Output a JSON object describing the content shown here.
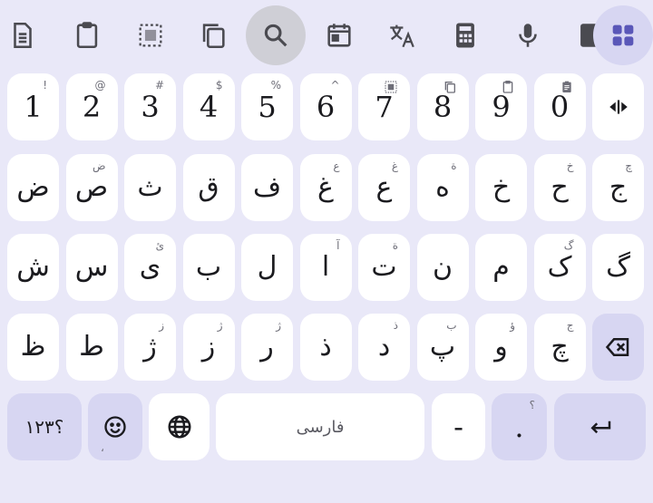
{
  "toolbar": {
    "items": [
      "clipboard-text",
      "clipboard",
      "select-all",
      "copy",
      "search",
      "calendar",
      "translate",
      "calculator",
      "microphone",
      "more",
      "apps-grid"
    ]
  },
  "keyboard": {
    "number_row": [
      {
        "main": "1",
        "hint": "!"
      },
      {
        "main": "2",
        "hint": "@"
      },
      {
        "main": "3",
        "hint": "#"
      },
      {
        "main": "4",
        "hint": "$"
      },
      {
        "main": "5",
        "hint": "%"
      },
      {
        "main": "6",
        "hint": "^"
      },
      {
        "main": "7",
        "hint": "select-all-icon"
      },
      {
        "main": "8",
        "hint": "copy-icon"
      },
      {
        "main": "9",
        "hint": "clipboard-icon"
      },
      {
        "main": "0",
        "hint": "clipboard-text-icon"
      }
    ],
    "cursor_key_icon": "cursor-move-icon",
    "row1": [
      {
        "main": "ض",
        "hint": ""
      },
      {
        "main": "ص",
        "hint": "ض"
      },
      {
        "main": "ث",
        "hint": ""
      },
      {
        "main": "ق",
        "hint": ""
      },
      {
        "main": "ف",
        "hint": ""
      },
      {
        "main": "غ",
        "hint": "ع"
      },
      {
        "main": "ع",
        "hint": "غ"
      },
      {
        "main": "ه",
        "hint": "ة"
      },
      {
        "main": "خ",
        "hint": ""
      },
      {
        "main": "ح",
        "hint": "خ"
      },
      {
        "main": "ج",
        "hint": "چ"
      }
    ],
    "row2": [
      {
        "main": "ش",
        "hint": ""
      },
      {
        "main": "س",
        "hint": ""
      },
      {
        "main": "ی",
        "hint": "ئ"
      },
      {
        "main": "ب",
        "hint": ""
      },
      {
        "main": "ل",
        "hint": ""
      },
      {
        "main": "ا",
        "hint": "آ"
      },
      {
        "main": "ت",
        "hint": "ة"
      },
      {
        "main": "ن",
        "hint": ""
      },
      {
        "main": "م",
        "hint": ""
      },
      {
        "main": "ک",
        "hint": "گ"
      },
      {
        "main": "گ",
        "hint": ""
      }
    ],
    "row3": [
      {
        "main": "ظ",
        "hint": ""
      },
      {
        "main": "ط",
        "hint": ""
      },
      {
        "main": "ژ",
        "hint": "ز"
      },
      {
        "main": "ز",
        "hint": "ژ"
      },
      {
        "main": "ر",
        "hint": "ژ"
      },
      {
        "main": "ذ",
        "hint": ""
      },
      {
        "main": "د",
        "hint": "ذ"
      },
      {
        "main": "پ",
        "hint": "ب"
      },
      {
        "main": "و",
        "hint": "ؤ"
      },
      {
        "main": "چ",
        "hint": "ج"
      }
    ],
    "backspace_icon": "backspace-icon",
    "bottom": {
      "symbols_label": "۱۲۳؟",
      "emoji_hint": "،",
      "space_label": "فارسی",
      "dash_label": "-",
      "period_label": ".",
      "period_hint": "؟",
      "enter_icon": "enter-icon"
    }
  },
  "colors": {
    "background": "#e9e8f8",
    "key": "#ffffff",
    "special_key": "#d7d6f2",
    "text": "#1b1b1f",
    "hint": "#6e6e78"
  }
}
